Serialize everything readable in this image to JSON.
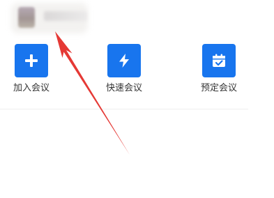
{
  "actions": [
    {
      "label": "加入会议",
      "icon": "plus-icon"
    },
    {
      "label": "快速会议",
      "icon": "lightning-icon"
    },
    {
      "label": "预定会议",
      "icon": "calendar-check-icon"
    }
  ],
  "colors": {
    "accent": "#1875ee",
    "annotation": "#e53935",
    "label": "#333333",
    "divider": "#efefef"
  }
}
